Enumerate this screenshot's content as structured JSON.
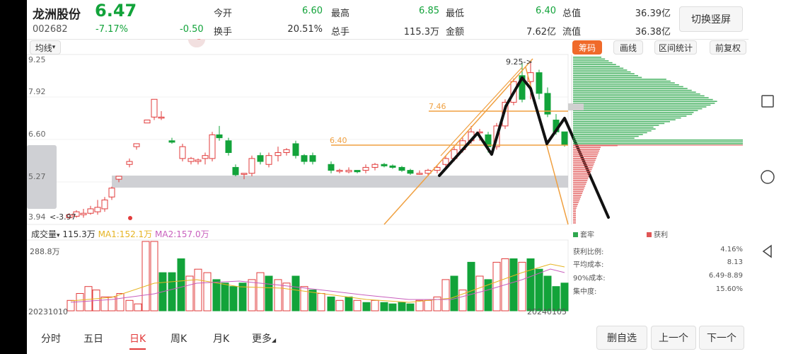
{
  "stock": {
    "name": "龙洲股份",
    "price": "6.47",
    "code": "002682",
    "change_pct": "-7.17%",
    "change": "-0.50"
  },
  "quote": [
    {
      "label": "今开",
      "value": "6.60",
      "color": "green"
    },
    {
      "label": "最高",
      "value": "6.85",
      "color": "green"
    },
    {
      "label": "最低",
      "value": "6.40",
      "color": "green"
    },
    {
      "label": "总值",
      "value": "36.39亿",
      "color": "dark"
    },
    {
      "label": "换手",
      "value": "20.51%",
      "color": "dark"
    },
    {
      "label": "总手",
      "value": "115.3万",
      "color": "dark"
    },
    {
      "label": "金额",
      "value": "7.62亿",
      "color": "dark"
    },
    {
      "label": "流值",
      "value": "36.38亿",
      "color": "dark"
    }
  ],
  "switch_button": "切换竖屏",
  "chart": {
    "indicator": "均线",
    "indicator_arrow": "▾",
    "price_ticks": [
      "9.25",
      "7.92",
      "6.60",
      "5.27",
      "3.94"
    ],
    "low_annotation": "<-3.97",
    "annotations": {
      "high": "9.25->",
      "level_746": "7.46",
      "level_640": "6.40"
    },
    "volume_label": "成交量",
    "volume_value": "115.3万",
    "ma1": "MA1:152.1万",
    "ma2": "MA2:157.0万",
    "volume_max": "288.8万",
    "date_start": "20231010",
    "date_end": "20240105"
  },
  "chip_panel": {
    "tabs": [
      "筹码",
      "画线",
      "区间统计",
      "前复权"
    ],
    "legend": [
      {
        "label": "套牢",
        "color": "#2fa84f"
      },
      {
        "label": "获利",
        "color": "#e05555"
      }
    ],
    "stats": [
      {
        "label": "获利比例:",
        "value": "4.16%"
      },
      {
        "label": "平均成本:",
        "value": "8.13"
      },
      {
        "label": "90%成本:",
        "value": "6.49-8.89"
      },
      {
        "label": "集中度:",
        "value": "15.60%"
      }
    ]
  },
  "bottom_tabs": [
    "分时",
    "五日",
    "日K",
    "周K",
    "月K",
    "更多"
  ],
  "bottom_tabs_active": "日K",
  "bottom_buttons": [
    "删自选",
    "上一个",
    "下一个"
  ],
  "colors": {
    "up": "#e23b3b",
    "down": "#12a33a",
    "ma1": "#e6b422",
    "ma2": "#c85fbd",
    "trend": "#f0a040"
  }
}
